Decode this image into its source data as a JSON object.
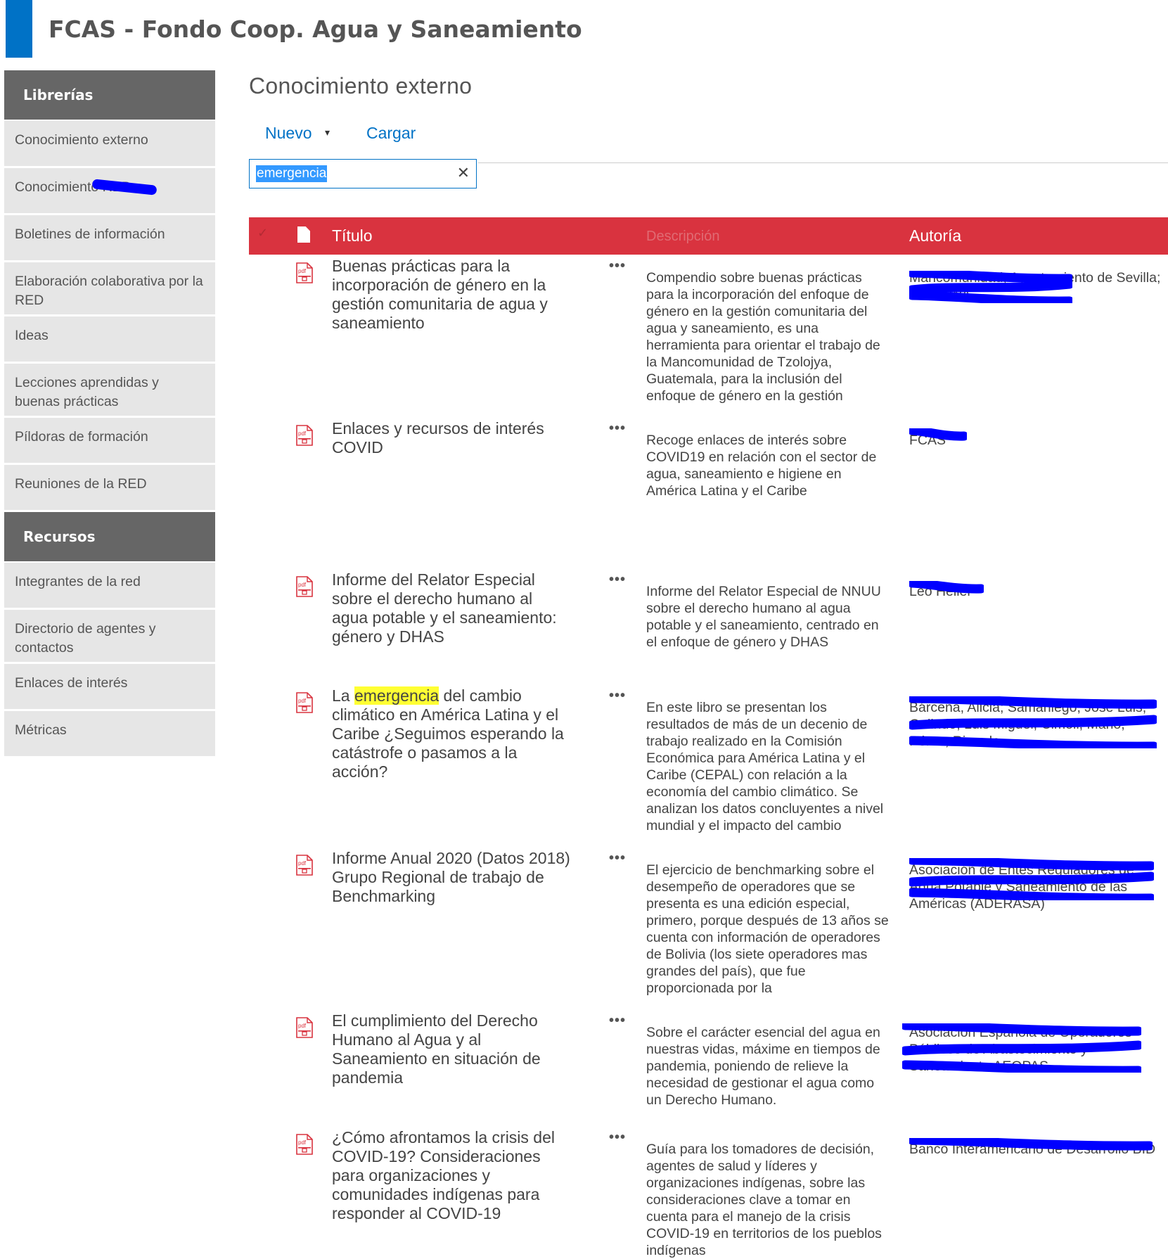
{
  "site": {
    "title": "FCAS - Fondo Coop. Agua y Saneamiento"
  },
  "sidebar": {
    "libraries_header": "Librerías",
    "libraries": [
      "Conocimiento externo",
      "Conocimiento RED",
      "Boletines de información",
      "Elaboración colaborativa por la RED",
      "Ideas",
      "Lecciones aprendidas y buenas prácticas",
      "Píldoras de formación",
      "Reuniones de la RED"
    ],
    "resources_header": "Recursos",
    "resources": [
      "Integrantes de la red",
      "Directorio de agentes y contactos",
      "Enlaces de interés",
      "Métricas"
    ]
  },
  "page": {
    "title": "Conocimiento externo"
  },
  "toolbar": {
    "new_label": "Nuevo",
    "dropdown_glyph": "▾",
    "upload_label": "Cargar"
  },
  "search": {
    "value": "emergencia",
    "clear_glyph": "✕"
  },
  "list": {
    "columns": {
      "check": "✓",
      "title": "Título",
      "description": "Descripción",
      "author": "Autoría"
    },
    "file_type": "pdf",
    "menu_glyph": "•••",
    "rows": [
      {
        "title": "Buenas prácticas para la incorporación de género en la gestión comunitaria de agua y saneamiento",
        "description": "Compendio sobre buenas prácticas para la incorporación del enfoque de género en la gestión comunitaria del agua y saneamiento, es una herramienta para orientar el trabajo de la Mancomunidad de Tzolojya, Guatemala, para la inclusión del enfoque de género en la gestión",
        "author": "Mancomunidad; Ayuntamiento de Sevilla; ONGAWA"
      },
      {
        "title": "Enlaces y recursos de interés COVID",
        "description": "Recoge enlaces de interés sobre COVID19 en relación con el sector de agua, saneamiento e higiene en América Latina y el Caribe",
        "author": "FCAS"
      },
      {
        "title": "Informe del Relator Especial sobre el derecho humano al agua potable y el saneamiento: género y DHAS",
        "description": "Informe del Relator Especial de NNUU sobre el derecho humano al agua potable y el saneamiento, centrado en el enfoque de género y DHAS",
        "author": "Léo Heller"
      },
      {
        "title_before": "La ",
        "title_highlight": "emergencia",
        "title_after": " del cambio climático en América Latina y el Caribe ¿Seguimos esperando la catástrofe o pasamos a la acción?",
        "description": "En este libro se presentan los resultados de más de un decenio de trabajo realizado en la Comisión Económica para América Latina y el Caribe (CEPAL) con relación a la economía del cambio climático. Se analizan los datos concluyentes a nivel mundial y el impacto del cambio",
        "author": "Bárcena, Alicia; Samaniego, José Luis; Galindo, Luis Miguel; Cimoli, Mario; Pérez, Ricardo"
      },
      {
        "title": "Informe Anual 2020 (Datos 2018) Grupo Regional de trabajo de Benchmarking",
        "description": "El ejercicio de benchmarking sobre el desempeño de operadores que se presenta es una edición especial, primero, porque después de 13 años se cuenta con información de operadores de Bolivia (los siete operadores mas grandes del país), que fue proporcionada por la",
        "author": "Asociación de Entes Reguladores de Agua Potable y Saneamiento de las Américas (ADERASA)"
      },
      {
        "title": "El cumplimiento del Derecho Humano al Agua y al Saneamiento en situación de pandemia",
        "description": "Sobre el carácter esencial del agua en nuestras vidas, máxime en tiempos de pandemia, poniendo de relieve la necesidad de gestionar el agua como un Derecho Humano.",
        "author": "Asociación Española de Operadores Públicos de Abastecimiento y Saneamiento AEOPAS"
      },
      {
        "title": "¿Cómo afrontamos la crisis del COVID-19? Consideraciones para organizaciones y comunidades indígenas para responder al COVID-19",
        "description": "Guía para los tomadores de decisión, agentes de salud y líderes y organizaciones indígenas, sobre las consideraciones clave a tomar en cuenta para el manejo de la crisis COVID-19 en territorios de los pueblos indígenas",
        "author": "Banco Interamericano de Desarrollo BID"
      }
    ]
  }
}
